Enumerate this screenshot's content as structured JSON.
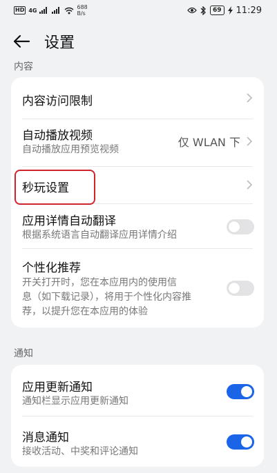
{
  "status_bar": {
    "hd": "HD",
    "signal": "4G",
    "net_speed_value": "688",
    "net_speed_unit": "B/s",
    "battery": "69",
    "time": "11:29"
  },
  "header": {
    "title": "设置"
  },
  "sections": {
    "content_label": "内容",
    "notify_label": "通知"
  },
  "content_rows": {
    "access_limit": {
      "title": "内容访问限制"
    },
    "autoplay": {
      "title": "自动播放视频",
      "subtitle": "自动播放应用预览视频",
      "value": "仅 WLAN 下"
    },
    "instant_play": {
      "title": "秒玩设置"
    },
    "translate": {
      "title": "应用详情自动翻译",
      "subtitle": "根据系统语言自动翻译应用详情介绍",
      "state": "off"
    },
    "personalize": {
      "title": "个性化推荐",
      "subtitle_line1": "开关打开时，您在本应用内的使用信",
      "subtitle_line2": "息（如下载记录），将用于个性化内容推",
      "subtitle_line3": "荐，以提升您在本应用的体验",
      "state": "off"
    }
  },
  "notify_rows": {
    "update": {
      "title": "应用更新通知",
      "subtitle": "通知栏显示应用更新通知",
      "state": "on"
    },
    "message": {
      "title": "消息通知",
      "subtitle": "接收活动、中奖和评论通知",
      "state": "on"
    }
  },
  "colors": {
    "accent": "#1a64e8",
    "highlight": "#d2232a",
    "background": "#f1f2f4"
  }
}
